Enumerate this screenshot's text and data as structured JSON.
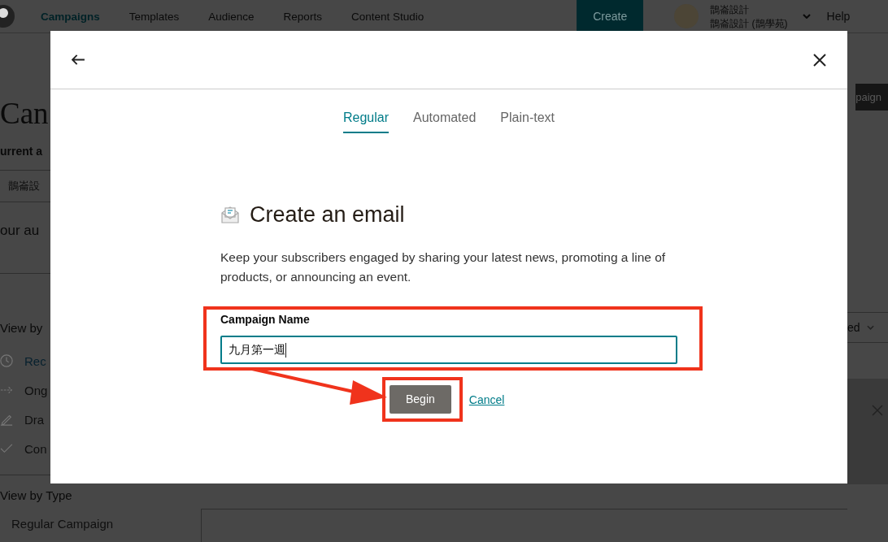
{
  "nav": {
    "items": [
      {
        "label": "Campaigns",
        "selected": true
      },
      {
        "label": "Templates",
        "selected": false
      },
      {
        "label": "Audience",
        "selected": false
      },
      {
        "label": "Reports",
        "selected": false
      },
      {
        "label": "Content Studio",
        "selected": false
      }
    ],
    "create_button": "Create",
    "account": {
      "line1": "鵲崙設計",
      "line2": "鵲崙設計 (鵲學苑)"
    },
    "help": "Help"
  },
  "background": {
    "page_title": "Can",
    "audience_label": "urrent a",
    "audience_select": "鵲崙設",
    "audience_text": "our au",
    "status_heading": "View by",
    "status_items": [
      {
        "label": "Rec",
        "selected": true
      },
      {
        "label": "Ong",
        "selected": false
      },
      {
        "label": "Dra",
        "selected": false
      },
      {
        "label": "Con",
        "selected": false
      }
    ],
    "type_heading": "View by Type",
    "type_items": [
      {
        "label": "Regular Campaign"
      }
    ],
    "campaign_button": "paign",
    "sort_select": "ed"
  },
  "modal": {
    "tabs": [
      {
        "label": "Regular",
        "selected": true
      },
      {
        "label": "Automated",
        "selected": false
      },
      {
        "label": "Plain-text",
        "selected": false
      }
    ],
    "title": "Create an email",
    "description": "Keep your subscribers engaged by sharing your latest news, promoting a line of products, or announcing an event.",
    "field": {
      "label": "Campaign Name",
      "value": "九月第一週"
    },
    "begin_button": "Begin",
    "cancel_link": "Cancel"
  }
}
